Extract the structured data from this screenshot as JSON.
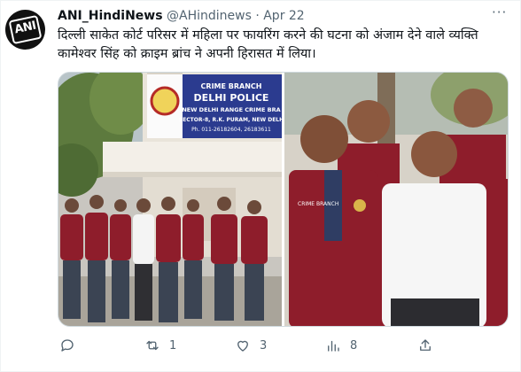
{
  "tweet": {
    "author_name": "ANI_HindiNews",
    "author_handle": "@AHindinews",
    "separator": "·",
    "date": "Apr 22",
    "more_label": "···",
    "avatar_text": "ANI",
    "text": "दिल्ली साकेत कोर्ट परिसर में महिला पर फायरिंग करने की घटना को अंजाम देने वाले व्यक्ति कामेश्वर सिंह को क्राइम ब्रांच ने अपनी हिरासत में लिया।"
  },
  "media": {
    "sign_lines": [
      "CRIME BRANCH",
      "DELHI POLICE",
      "NEW DELHI RANGE CRIME BRA",
      "SECTOR-8, R.K. PURAM, NEW DELH",
      "Ph. 011-26182604, 26183611"
    ],
    "vest_text": "CRIME BRANCH"
  },
  "actions": {
    "reply_count": "",
    "retweet_count": "1",
    "like_count": "3",
    "views_count": "8"
  },
  "icons": {
    "reply": "reply-icon",
    "retweet": "retweet-icon",
    "like": "like-icon",
    "views": "views-icon",
    "share": "share-icon"
  },
  "colors": {
    "text": "#0f1419",
    "secondary": "#536471",
    "vest": "#8e1d2b",
    "sign_blue": "#2b3b8f"
  }
}
